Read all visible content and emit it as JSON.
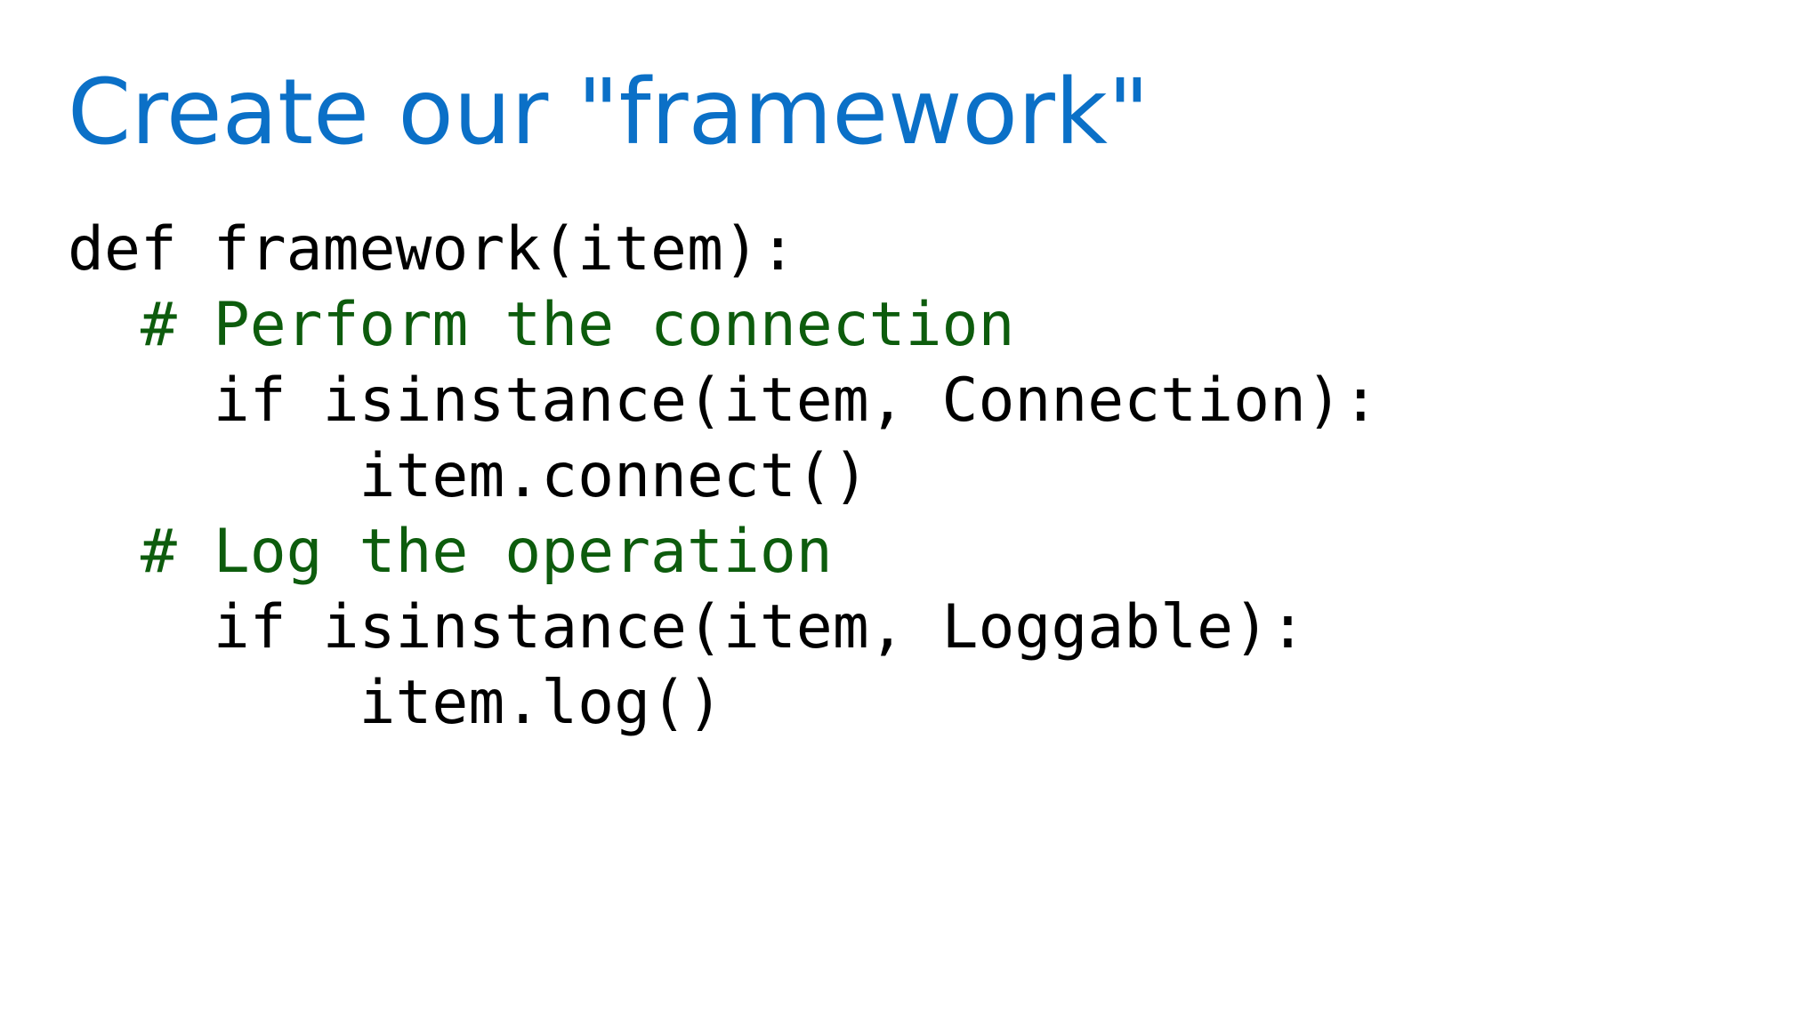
{
  "slide": {
    "title": "Create our \"framework\"",
    "code_lines": [
      {
        "kind": "code",
        "indent": 0,
        "text": "def framework(item):"
      },
      {
        "kind": "comment",
        "indent": 2,
        "text": "# Perform the connection"
      },
      {
        "kind": "code",
        "indent": 4,
        "text": "if isinstance(item, Connection):"
      },
      {
        "kind": "code",
        "indent": 8,
        "text": "item.connect()"
      },
      {
        "kind": "comment",
        "indent": 2,
        "text": "# Log the operation"
      },
      {
        "kind": "code",
        "indent": 4,
        "text": "if isinstance(item, Loggable):"
      },
      {
        "kind": "code",
        "indent": 8,
        "text": "item.log()"
      }
    ]
  },
  "colors": {
    "title": "#0b70c7",
    "code": "#000000",
    "comment": "#0d5c0d",
    "background": "#ffffff"
  }
}
